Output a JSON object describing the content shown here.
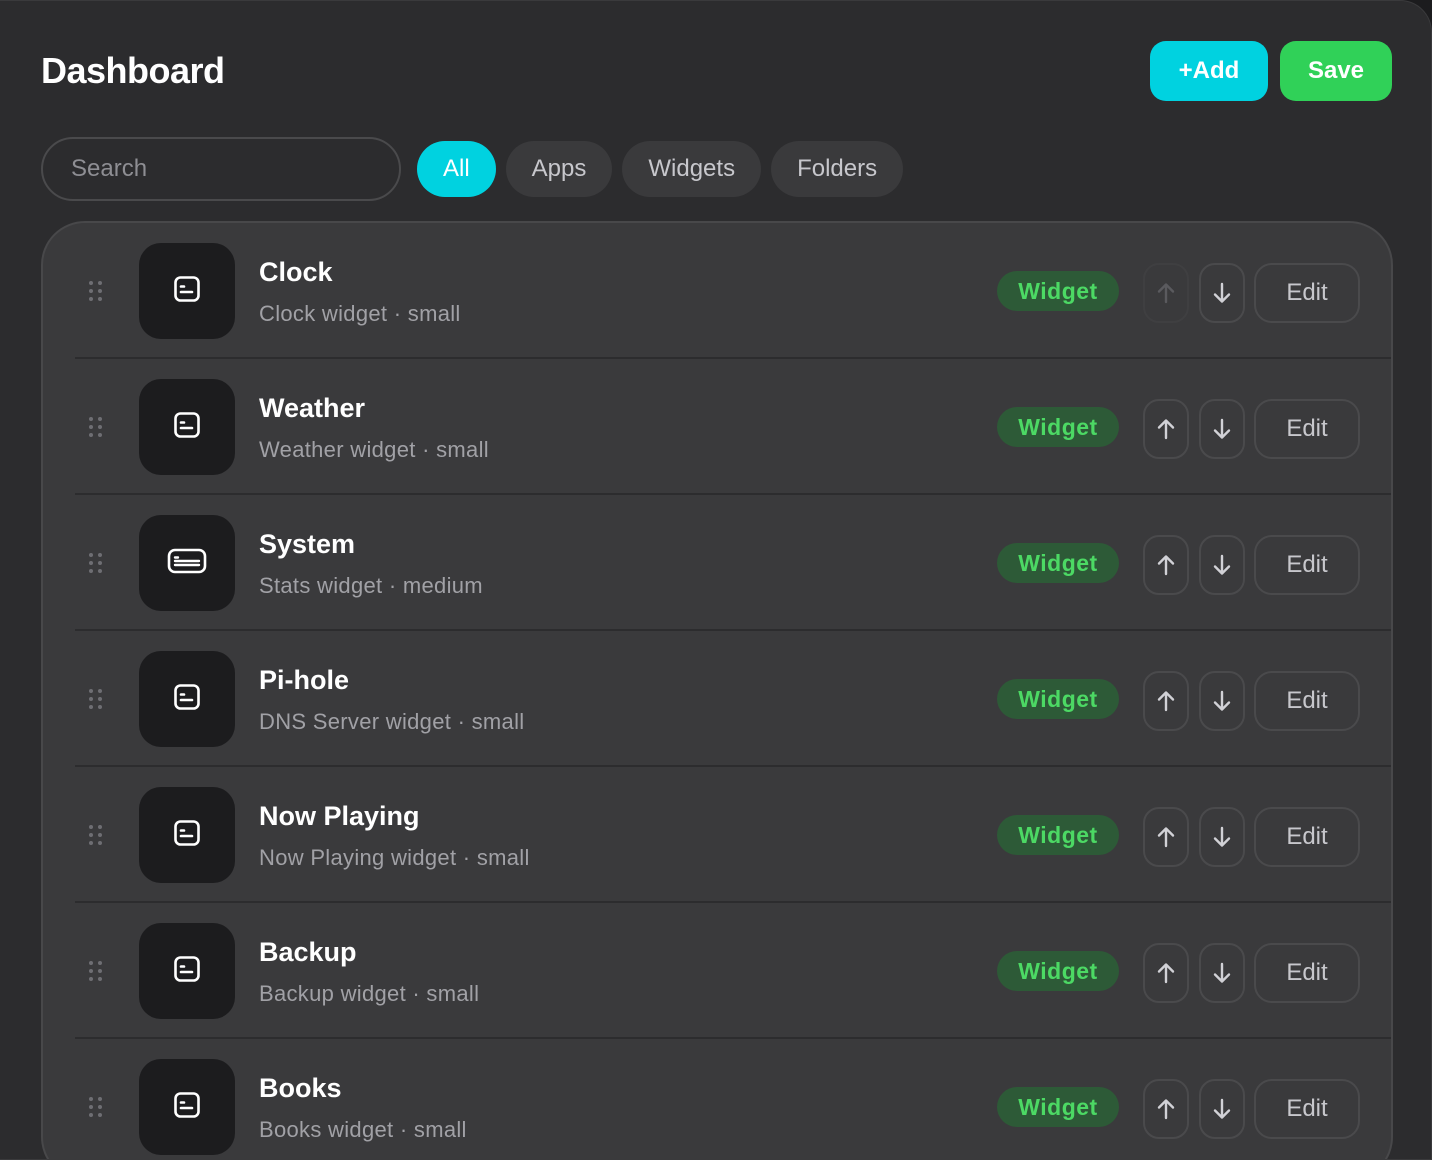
{
  "header": {
    "title": "Dashboard",
    "add_label": "+Add",
    "save_label": "Save"
  },
  "filters": {
    "search_placeholder": "Search",
    "chips": [
      "All",
      "Apps",
      "Widgets",
      "Folders"
    ],
    "active": "All"
  },
  "colors": {
    "accent": "#00d2e0",
    "save": "#30d158",
    "badge_bg": "#2d5a37",
    "badge_text": "#4cd964"
  },
  "rows": [
    {
      "title": "Clock",
      "subtitle": "Clock widget · small",
      "badge": "Widget",
      "edit_label": "Edit",
      "icon": "small-widget-icon",
      "up_disabled": true
    },
    {
      "title": "Weather",
      "subtitle": "Weather widget · small",
      "badge": "Widget",
      "edit_label": "Edit",
      "icon": "small-widget-icon",
      "up_disabled": false
    },
    {
      "title": "System",
      "subtitle": "Stats widget · medium",
      "badge": "Widget",
      "edit_label": "Edit",
      "icon": "medium-widget-icon",
      "up_disabled": false
    },
    {
      "title": "Pi-hole",
      "subtitle": "DNS Server widget · small",
      "badge": "Widget",
      "edit_label": "Edit",
      "icon": "small-widget-icon",
      "up_disabled": false
    },
    {
      "title": "Now Playing",
      "subtitle": "Now Playing widget · small",
      "badge": "Widget",
      "edit_label": "Edit",
      "icon": "small-widget-icon",
      "up_disabled": false
    },
    {
      "title": "Backup",
      "subtitle": "Backup widget · small",
      "badge": "Widget",
      "edit_label": "Edit",
      "icon": "small-widget-icon",
      "up_disabled": false
    },
    {
      "title": "Books",
      "subtitle": "Books widget · small",
      "badge": "Widget",
      "edit_label": "Edit",
      "icon": "small-widget-icon",
      "up_disabled": false
    }
  ]
}
